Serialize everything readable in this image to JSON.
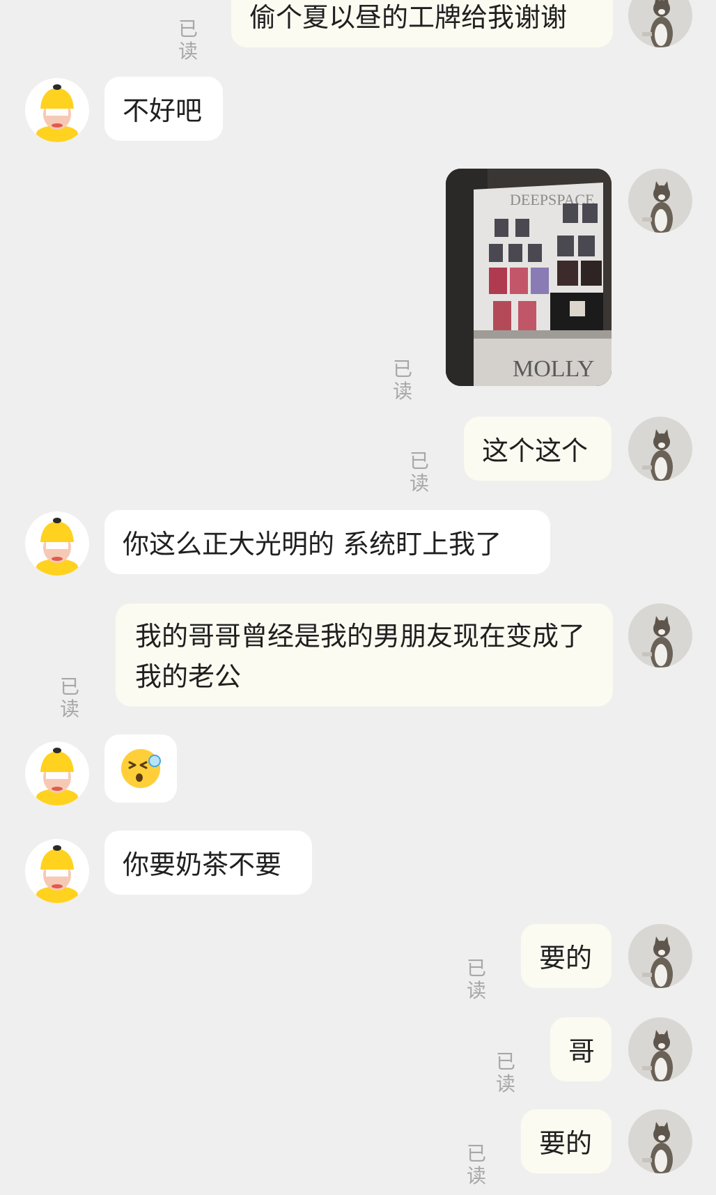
{
  "read_label": "已读",
  "messages": [
    {
      "side": "out",
      "text": "偷个夏以昼的工牌给我谢谢"
    },
    {
      "side": "in",
      "text": "不好吧"
    },
    {
      "side": "out",
      "type": "image",
      "image_texts": [
        "DEEPSPACE",
        "MOLLY"
      ]
    },
    {
      "side": "out",
      "text": "这个这个"
    },
    {
      "side": "in",
      "text": "你这么正大光明的 系统盯上我了"
    },
    {
      "side": "out",
      "text": "我的哥哥曾经是我的男朋友现在变成了我的老公"
    },
    {
      "side": "in",
      "type": "emoji",
      "emoji": "sweat-squint-emoji"
    },
    {
      "side": "in",
      "text": "你要奶茶不要"
    },
    {
      "side": "out",
      "text": "要的"
    },
    {
      "side": "out",
      "text": "哥"
    },
    {
      "side": "out",
      "text": "要的"
    }
  ],
  "colors": {
    "background": "#efefef",
    "incoming_bubble": "#ffffff",
    "outgoing_bubble": "#fbfbf1",
    "read_text": "#a7a7a7",
    "avatar_yellow": "#ffd21f"
  }
}
